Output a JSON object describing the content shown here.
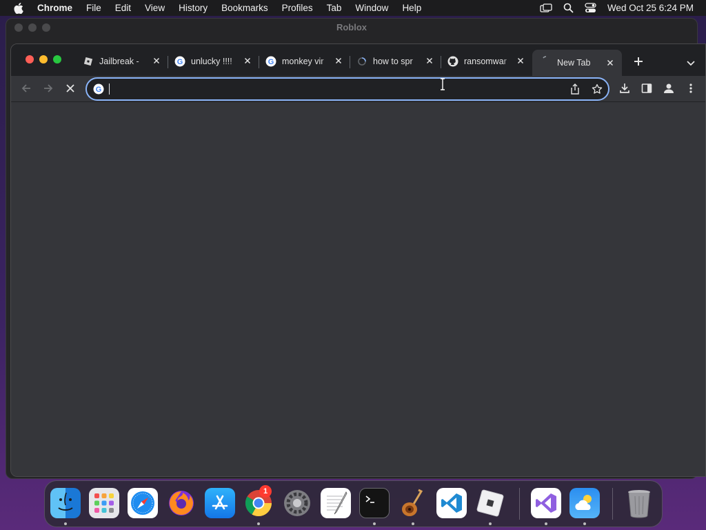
{
  "menubar": {
    "app": "Chrome",
    "items": [
      "File",
      "Edit",
      "View",
      "History",
      "Bookmarks",
      "Profiles",
      "Tab",
      "Window",
      "Help"
    ],
    "clock": "Wed Oct 25  6:24 PM"
  },
  "background_window": {
    "title": "Roblox"
  },
  "tabs": [
    {
      "label": "Jailbreak -",
      "favicon": "roblox-icon"
    },
    {
      "label": "unlucky !!!!",
      "favicon": "google-icon"
    },
    {
      "label": "monkey vir",
      "favicon": "google-icon"
    },
    {
      "label": "how to spr",
      "favicon": "loading-icon"
    },
    {
      "label": "ransomwar",
      "favicon": "github-icon"
    },
    {
      "label": "New Tab",
      "favicon": "loading-icon",
      "active": true
    }
  ],
  "omnibox": {
    "value": "",
    "placeholder": ""
  },
  "dock": {
    "apps": [
      "Finder",
      "Launchpad",
      "Safari",
      "Firefox",
      "App Store",
      "Chrome",
      "System Settings",
      "TextEdit",
      "Terminal",
      "GarageBand",
      "Visual Studio Code",
      "Roblox",
      "Visual Studio",
      "Weather",
      "Trash"
    ],
    "settings_badge": "1"
  },
  "colors": {
    "accent": "#8ab4f8",
    "tabstrip": "#202124",
    "toolbar": "#35363a"
  }
}
